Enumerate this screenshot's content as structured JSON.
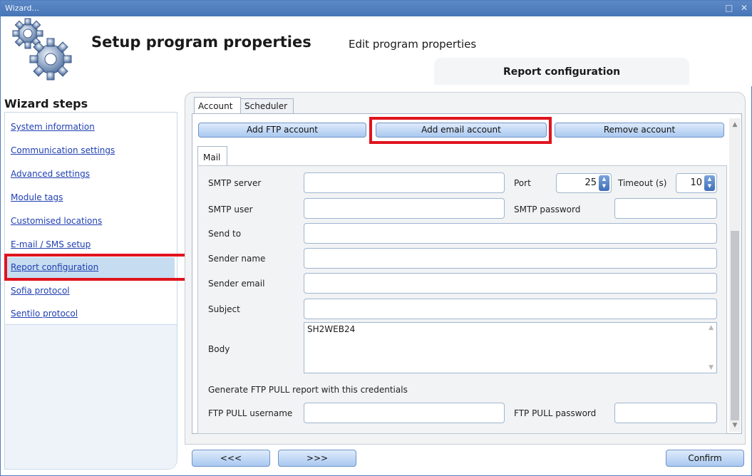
{
  "window": {
    "title": "Wizard...",
    "controls": [
      "□",
      "✕"
    ]
  },
  "header": {
    "title": "Setup program properties",
    "subtitle": "Edit program properties",
    "section": "Report configuration"
  },
  "sidebar": {
    "title": "Wizard steps",
    "items": [
      {
        "label": "System information"
      },
      {
        "label": "Communication settings"
      },
      {
        "label": "Advanced settings"
      },
      {
        "label": "Module tags"
      },
      {
        "label": "Customised locations"
      },
      {
        "label": "E-mail / SMS setup"
      },
      {
        "label": "Report configuration",
        "active": true
      },
      {
        "label": "Sofia protocol"
      },
      {
        "label": "Sentilo protocol"
      }
    ]
  },
  "tabs": [
    "Account",
    "Scheduler"
  ],
  "actions": {
    "add_ftp": "Add FTP account",
    "add_email": "Add email account",
    "remove": "Remove account"
  },
  "subtab": "Mail",
  "form": {
    "smtp_server_label": "SMTP server",
    "port_label": "Port",
    "port_value": "25",
    "timeout_label": "Timeout (s)",
    "timeout_value": "10",
    "smtp_user_label": "SMTP user",
    "smtp_password_label": "SMTP password",
    "send_to_label": "Send to",
    "sender_name_label": "Sender name",
    "sender_email_label": "Sender email",
    "subject_label": "Subject",
    "body_label": "Body",
    "body_value": "SH2WEB24",
    "ftp_pull_note": "Generate FTP PULL report with this credentials",
    "ftp_user_label": "FTP PULL username",
    "ftp_password_label": "FTP PULL password"
  },
  "footer": {
    "back": "<<<",
    "next": ">>>",
    "confirm": "Confirm"
  },
  "colors": {
    "titlebar": "#4f7dbf",
    "link": "#1f3fb2",
    "highlight": "#e0141e",
    "button": "#a9c8f0"
  }
}
